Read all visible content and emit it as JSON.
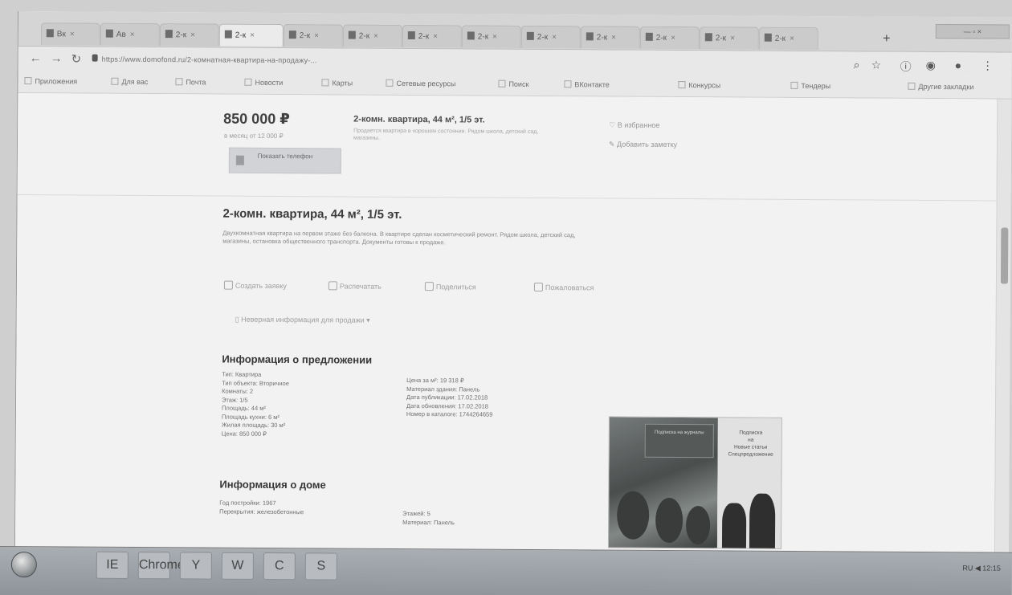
{
  "browser": {
    "tabs": [
      {
        "label": "Вк"
      },
      {
        "label": "Ав"
      },
      {
        "label": "2-к"
      },
      {
        "label": "2-к"
      },
      {
        "label": "2-к"
      },
      {
        "label": "2-к"
      },
      {
        "label": "2-к"
      },
      {
        "label": "2-к"
      },
      {
        "label": "2-к"
      },
      {
        "label": "2-к"
      },
      {
        "label": "2-к"
      },
      {
        "label": "2-к"
      },
      {
        "label": "2-к"
      }
    ],
    "new_tab": "+",
    "url": "https://www.domofond.ru/2-комнатная-квартира-на-продажу-...",
    "bookmarks": [
      "Приложения",
      "Для вас",
      "Почта",
      "Новости",
      "Карты",
      "Сетевые ресурсы",
      "Поиск",
      "ВКонтакте",
      "Конкурсы",
      "Тендеры",
      "Другие закладки"
    ]
  },
  "listing": {
    "price": "850 000 ₽",
    "price_per_m": "в месяц от 12 000 ₽",
    "show_phone": "Показать телефон",
    "summary_title": "2-комн. квартира, 44 м², 1/5 эт.",
    "summary_desc": "Продается квартира в хорошем состоянии. Рядом школа, детский сад, магазины.",
    "favorite": "В избранное",
    "add_note": "Добавить заметку",
    "title": "2-комн. квартира, 44 м², 1/5 эт.",
    "description": "Двухкомнатная квартира на первом этаже без балкона. В квартире сделан косметический ремонт. Рядом школа, детский сад, магазины, остановка общественного транспорта. Документы готовы к продаже.",
    "actions": [
      "Создать заявку",
      "Распечатать",
      "Поделиться",
      "Пожаловаться"
    ],
    "complaint": "Неверная информация для продажи"
  },
  "offer_info": {
    "title": "Информация о предложении",
    "left": [
      "Тип: Квартира",
      "Тип объекта: Вторичное",
      "Комнаты: 2",
      "Этаж: 1/5",
      "Площадь: 44 м²",
      "Площадь кухни: 6 м²",
      "Жилая площадь: 30 м²",
      "Цена: 850 000 ₽"
    ],
    "right": [
      "Цена за м²: 19 318 ₽",
      "Материал здания: Панель",
      "Дата публикации: 17.02.2018",
      "Дата обновления: 17.02.2018",
      "Номер в каталоге: 1744264659"
    ]
  },
  "house_info": {
    "title": "Информация о доме",
    "left": [
      "Год постройки: 1967",
      "Перекрытия: железобетонные"
    ],
    "right": [
      "Этажей: 5",
      "Материал: Панель"
    ]
  },
  "ad": {
    "sign": "Подписка на журналы",
    "text": [
      "Подписка",
      "на",
      "Новые статьи",
      "Спецпредложение"
    ]
  },
  "taskbar": {
    "apps": [
      "IE",
      "Chrome",
      "Y",
      "W",
      "C",
      "S"
    ],
    "tray": "RU  ◀  12:15"
  },
  "colors": {
    "accent": "#6a6a6a",
    "button": "#d9dde3"
  }
}
